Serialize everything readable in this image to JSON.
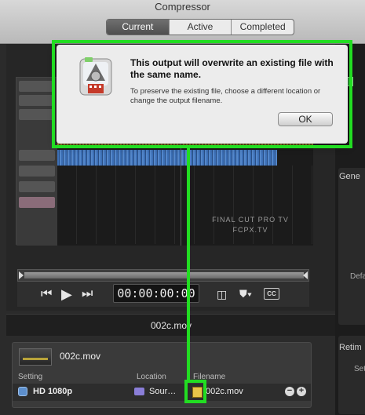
{
  "app": {
    "title": "Compressor"
  },
  "tabs": [
    {
      "label": "Current",
      "active": true
    },
    {
      "label": "Active",
      "active": false
    },
    {
      "label": "Completed",
      "active": false
    }
  ],
  "alert": {
    "title": "This output will overwrite an existing file with the same name.",
    "message": "To preserve the existing file, choose a different location or change the output filename.",
    "ok_label": "OK"
  },
  "viewer": {
    "watermark_line1": "FINAL CUT PRO TV",
    "watermark_line2": "FCPX.TV"
  },
  "playback": {
    "timecode": "00:00:00:00",
    "cc_label": "CC"
  },
  "source": {
    "filename": "002c.mov"
  },
  "job": {
    "name": "002c.mov",
    "columns": {
      "setting": "Setting",
      "location": "Location",
      "filename": "Filename"
    },
    "output": {
      "setting": "HD 1080p",
      "location": "Sour…",
      "filename": "002c.mov"
    }
  },
  "inspector": {
    "general_label": "Gene",
    "default_label": "Defa",
    "retime_label": "Retim",
    "set_label": "Set"
  },
  "colors": {
    "highlight": "#22dd22",
    "accent_blue": "#5d8fcc"
  }
}
